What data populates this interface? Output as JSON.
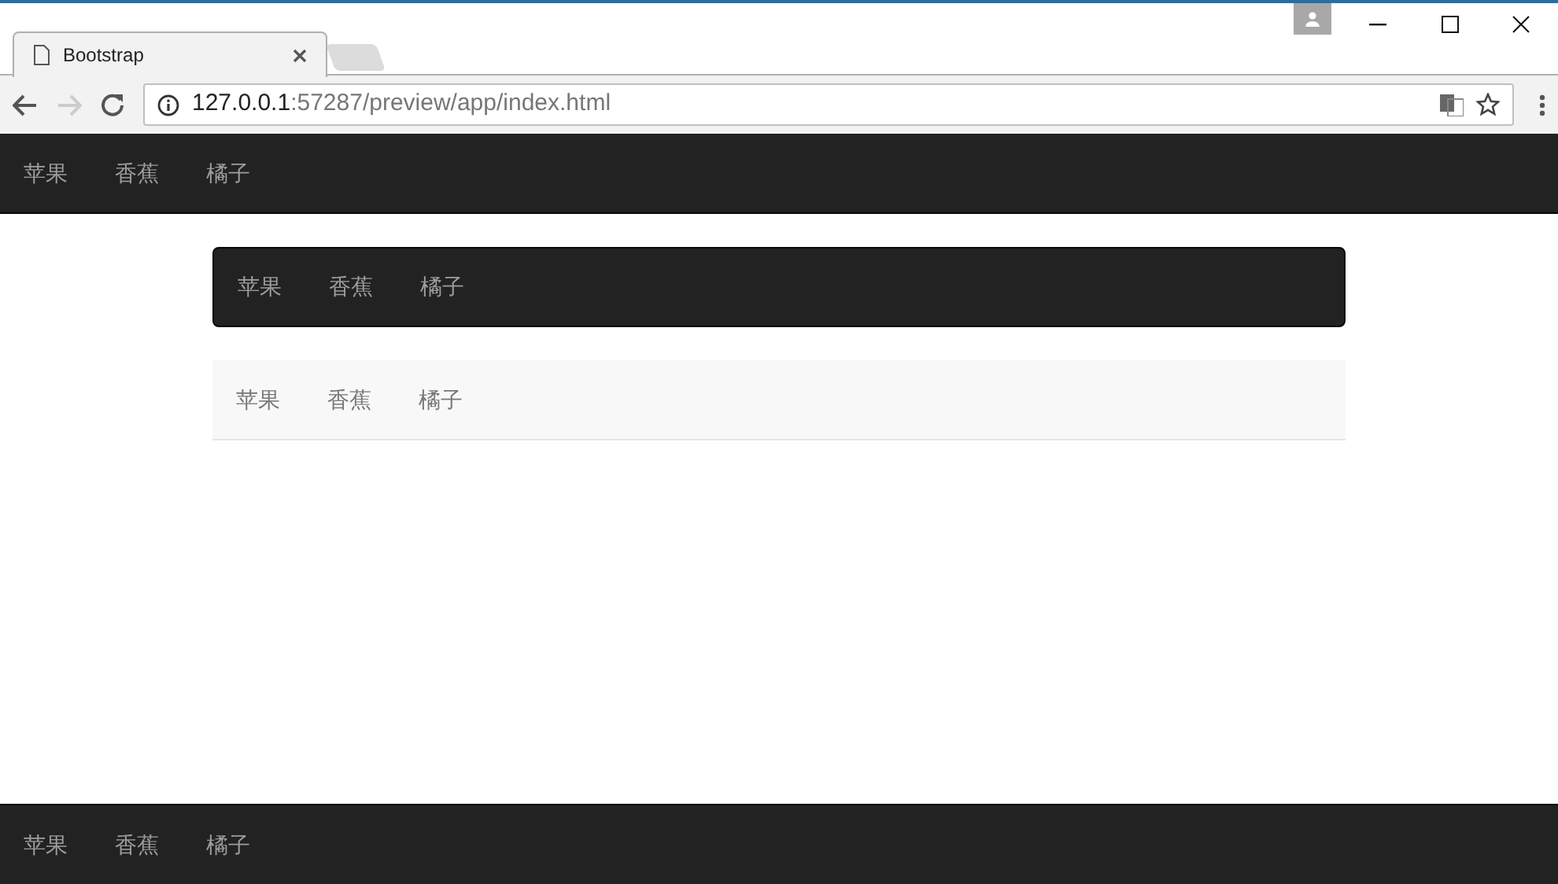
{
  "browser": {
    "tab": {
      "title": "Bootstrap"
    },
    "url_host": "127.0.0.1",
    "url_path": ":57287/preview/app/index.html"
  },
  "top_navbar": {
    "kind": "inverse",
    "items": [
      "苹果",
      "香蕉",
      "橘子"
    ]
  },
  "container_navbars": [
    {
      "kind": "inverse",
      "items": [
        "苹果",
        "香蕉",
        "橘子"
      ]
    },
    {
      "kind": "default",
      "items": [
        "苹果",
        "香蕉",
        "橘子"
      ]
    }
  ],
  "bottom_navbar": {
    "kind": "inverse",
    "items": [
      "苹果",
      "香蕉",
      "橘子"
    ]
  }
}
